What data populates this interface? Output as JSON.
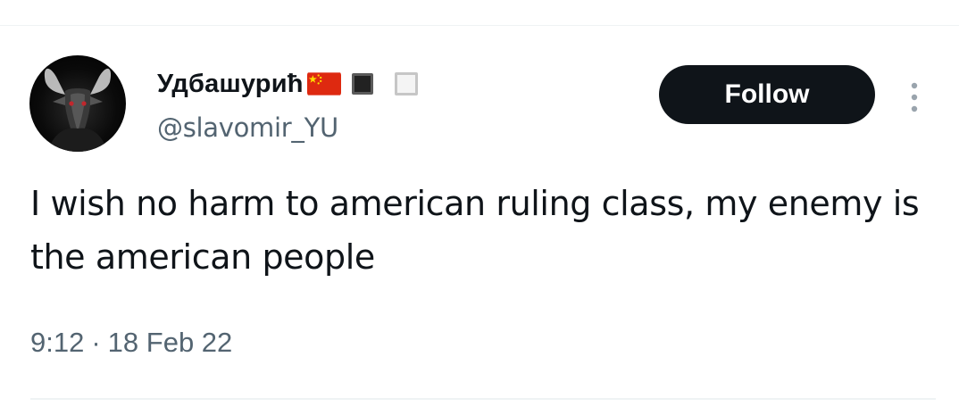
{
  "user": {
    "display_name": "Удбашурић",
    "handle": "@slavomir_YU",
    "name_emojis": [
      "china-flag-icon",
      "black-square-icon",
      "white-square-icon"
    ]
  },
  "actions": {
    "follow_label": "Follow"
  },
  "tweet": {
    "text": "I wish no harm to american ruling class, my enemy is the american people",
    "time": "9:12",
    "separator": "·",
    "date": "18 Feb 22"
  },
  "colors": {
    "primary_text": "#0f1419",
    "secondary_text": "#536471",
    "follow_bg": "#0f1419",
    "follow_text": "#ffffff",
    "divider": "#eff3f4"
  }
}
